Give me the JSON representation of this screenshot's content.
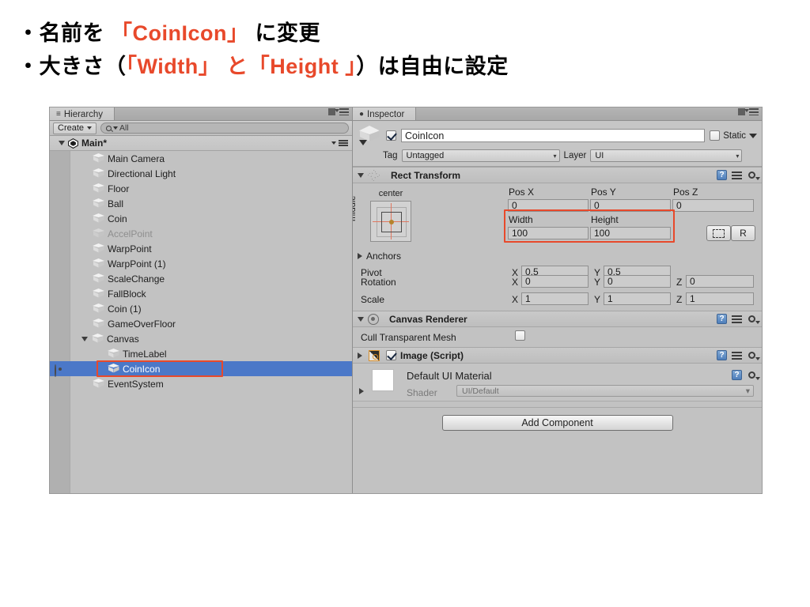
{
  "slide": {
    "lines": [
      {
        "prefix": "・名前を ",
        "highlight": "「CoinIcon」",
        "suffix": " に変更"
      },
      {
        "prefix": "・大きさ（",
        "highlight": "「Width」 と「Height 」",
        "suffix": "）は自由に設定"
      }
    ]
  },
  "colors": {
    "accent_red": "#e8492b",
    "selection_blue": "#4b78c8",
    "panel_bg": "#c2c2c2"
  },
  "hierarchy": {
    "tab_label": "Hierarchy",
    "tab_icon": "hierarchy-icon",
    "create_label": "Create",
    "search_placeholder": "All",
    "search_value": "All",
    "scene_name": "Main*",
    "items": [
      {
        "label": "Main Camera",
        "depth": 2,
        "dim": false,
        "selected": false,
        "expandable": false
      },
      {
        "label": "Directional Light",
        "depth": 2,
        "dim": false,
        "selected": false,
        "expandable": false
      },
      {
        "label": "Floor",
        "depth": 2,
        "dim": false,
        "selected": false,
        "expandable": false
      },
      {
        "label": "Ball",
        "depth": 2,
        "dim": false,
        "selected": false,
        "expandable": false
      },
      {
        "label": "Coin",
        "depth": 2,
        "dim": false,
        "selected": false,
        "expandable": false
      },
      {
        "label": "AccelPoint",
        "depth": 2,
        "dim": true,
        "selected": false,
        "expandable": false
      },
      {
        "label": "WarpPoint",
        "depth": 2,
        "dim": false,
        "selected": false,
        "expandable": false
      },
      {
        "label": "WarpPoint (1)",
        "depth": 2,
        "dim": false,
        "selected": false,
        "expandable": false
      },
      {
        "label": "ScaleChange",
        "depth": 2,
        "dim": false,
        "selected": false,
        "expandable": false
      },
      {
        "label": "FallBlock",
        "depth": 2,
        "dim": false,
        "selected": false,
        "expandable": false
      },
      {
        "label": "Coin (1)",
        "depth": 2,
        "dim": false,
        "selected": false,
        "expandable": false
      },
      {
        "label": "GameOverFloor",
        "depth": 2,
        "dim": false,
        "selected": false,
        "expandable": false
      },
      {
        "label": "Canvas",
        "depth": 2,
        "dim": false,
        "selected": false,
        "expandable": true
      },
      {
        "label": "TimeLabel",
        "depth": 3,
        "dim": false,
        "selected": false,
        "expandable": false
      },
      {
        "label": "CoinIcon",
        "depth": 3,
        "dim": false,
        "selected": true,
        "expandable": false
      },
      {
        "label": "EventSystem",
        "depth": 2,
        "dim": false,
        "selected": false,
        "expandable": false
      }
    ]
  },
  "inspector": {
    "tab_label": "Inspector",
    "tab_icon": "unity-inspector-icon",
    "object": {
      "enabled": true,
      "name": "CoinIcon",
      "static_label": "Static",
      "static_checked": false,
      "tag_label": "Tag",
      "tag_value": "Untagged",
      "layer_label": "Layer",
      "layer_value": "UI"
    },
    "rect_transform": {
      "title": "Rect Transform",
      "anchor_preset_h": "center",
      "anchor_preset_v": "middle",
      "pos_x_label": "Pos X",
      "pos_y_label": "Pos Y",
      "pos_z_label": "Pos Z",
      "pos_x": "0",
      "pos_y": "0",
      "pos_z": "0",
      "width_label": "Width",
      "height_label": "Height",
      "width": "100",
      "height": "100",
      "blueprint_label": "",
      "raw_label": "R",
      "anchors_label": "Anchors",
      "pivot_label": "Pivot",
      "pivot_x": "0.5",
      "pivot_y": "0.5",
      "rotation_label": "Rotation",
      "rotation_x": "0",
      "rotation_y": "0",
      "rotation_z": "0",
      "scale_label": "Scale",
      "scale_x": "1",
      "scale_y": "1",
      "scale_z": "1",
      "axis_x": "X",
      "axis_y": "Y",
      "axis_z": "Z"
    },
    "canvas_renderer": {
      "title": "Canvas Renderer",
      "cull_label": "Cull Transparent Mesh",
      "cull_checked": false
    },
    "image_script": {
      "title": "Image (Script)",
      "enabled": true
    },
    "material": {
      "name": "Default UI Material",
      "shader_label": "Shader",
      "shader_value": "UI/Default"
    },
    "add_component_label": "Add Component"
  }
}
